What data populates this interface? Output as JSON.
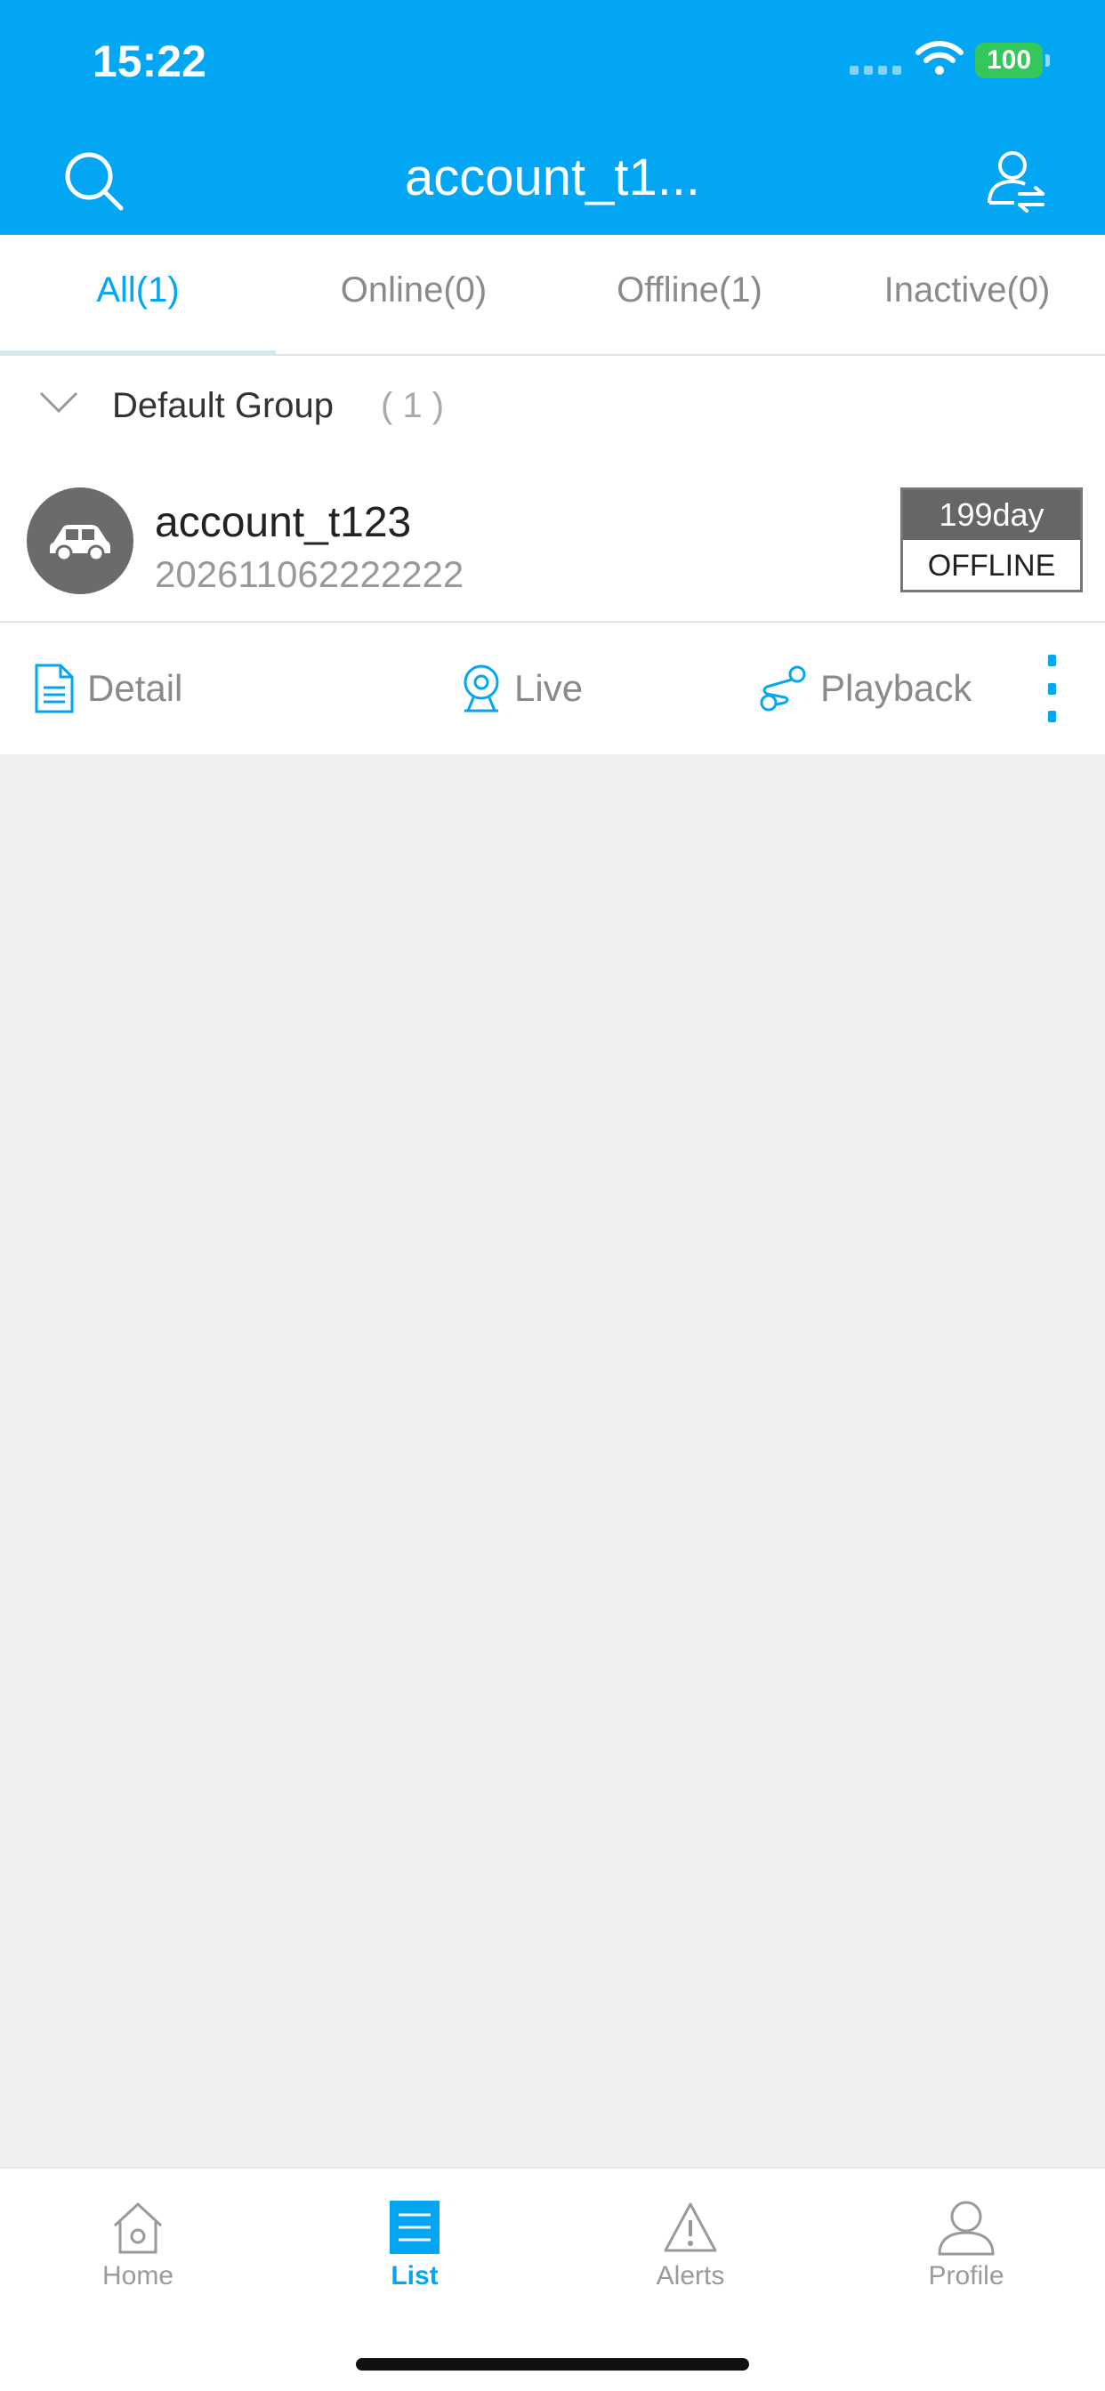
{
  "status_bar": {
    "time": "15:22",
    "battery": "100"
  },
  "header": {
    "title": "account_t1..."
  },
  "tabs": [
    {
      "label": "All(1)"
    },
    {
      "label": "Online(0)"
    },
    {
      "label": "Offline(1)"
    },
    {
      "label": "Inactive(0)"
    }
  ],
  "group": {
    "name": "Default Group",
    "count": "( 1 )"
  },
  "device": {
    "name": "account_t123",
    "id": "202611062222222",
    "days": "199day",
    "status": "OFFLINE"
  },
  "actions": {
    "detail": "Detail",
    "live": "Live",
    "playback": "Playback"
  },
  "tabbar": [
    {
      "label": "Home"
    },
    {
      "label": "List"
    },
    {
      "label": "Alerts"
    },
    {
      "label": "Profile"
    }
  ],
  "colors": {
    "accent": "#02a6f2",
    "battery": "#34c759"
  }
}
